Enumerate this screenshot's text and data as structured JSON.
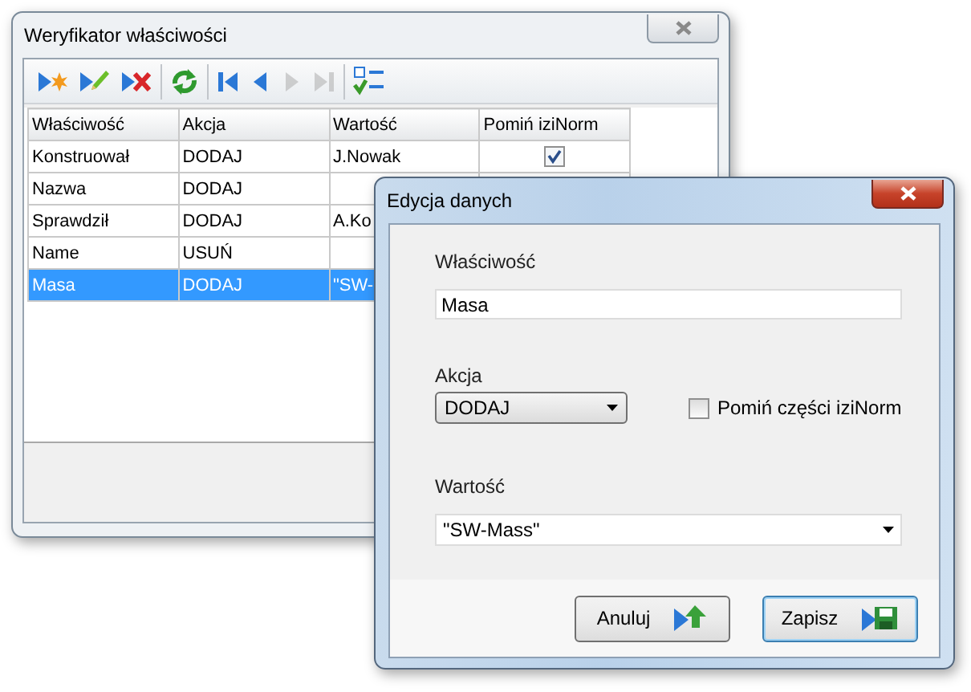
{
  "main_window": {
    "title": "Weryfikator właściwości",
    "toolbar_groups": [
      [
        {
          "kind": "add",
          "disabled": false
        },
        {
          "kind": "edit",
          "disabled": false
        },
        {
          "kind": "delete",
          "disabled": false
        }
      ],
      [
        {
          "kind": "refresh",
          "disabled": false
        }
      ],
      [
        {
          "kind": "first",
          "disabled": false
        },
        {
          "kind": "prev",
          "disabled": false
        },
        {
          "kind": "next",
          "disabled": true
        },
        {
          "kind": "last",
          "disabled": true
        }
      ],
      [
        {
          "kind": "columns",
          "disabled": false
        }
      ]
    ],
    "table": {
      "columns": [
        "Właściwość",
        "Akcja",
        "Wartość",
        "Pomiń iziNorm"
      ],
      "rows": [
        {
          "cells": [
            "Konstruował",
            "DODAJ",
            "J.Nowak"
          ],
          "skip_izinorm": true,
          "selected": false
        },
        {
          "cells": [
            "Nazwa",
            "DODAJ",
            ""
          ],
          "selected": false
        },
        {
          "cells": [
            "Sprawdził",
            "DODAJ",
            "A.Ko"
          ],
          "selected": false
        },
        {
          "cells": [
            "Name",
            "USUŃ",
            ""
          ],
          "selected": false
        },
        {
          "cells": [
            "Masa",
            "DODAJ",
            "\"SW-"
          ],
          "selected": true
        }
      ]
    }
  },
  "dialog": {
    "title": "Edycja danych",
    "property": {
      "label": "Właściwość",
      "value": "Masa"
    },
    "action": {
      "label": "Akcja",
      "value": "DODAJ"
    },
    "skip_checkbox": {
      "label": "Pomiń części iziNorm",
      "checked": false
    },
    "value": {
      "label": "Wartość",
      "value": "\"SW-Mass\""
    },
    "buttons": [
      {
        "label": "Anuluj",
        "kind": "cancel",
        "focused": false
      },
      {
        "label": "Zapisz",
        "kind": "save",
        "focused": true
      }
    ]
  }
}
